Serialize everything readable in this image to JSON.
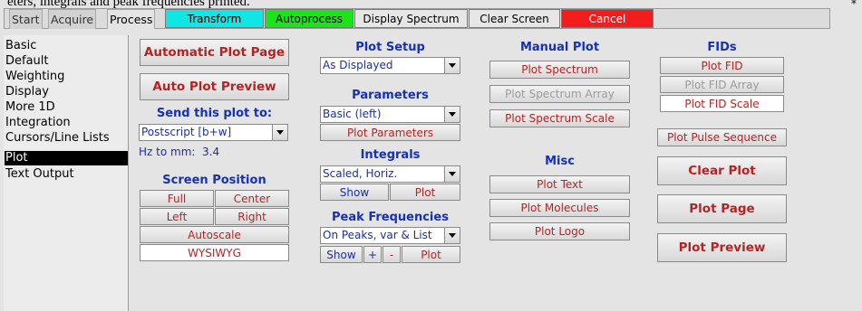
{
  "header_cut_text": "eters, integrals and peak frequencies printed.",
  "corner_mark": "*",
  "tabs": [
    "Start",
    "Acquire",
    "Process"
  ],
  "toolbar": {
    "transform": "Transform",
    "autoprocess": "Autoprocess",
    "display_spectrum": "Display Spectrum",
    "clear_screen": "Clear Screen",
    "cancel": "Cancel"
  },
  "sidebar": {
    "items": [
      "Basic",
      "Default",
      "Weighting",
      "Display",
      "More 1D",
      "Integration",
      "Cursors/Line Lists",
      "Plot",
      "Text Output"
    ],
    "selected": "Plot"
  },
  "col1": {
    "automatic_plot_page": "Automatic Plot Page",
    "auto_plot_preview": "Auto Plot Preview",
    "send_to_label": "Send this plot to:",
    "send_to_value": "Postscript [b+w]",
    "hz_to_mm_label": "Hz to mm:",
    "hz_to_mm_value": "3.4",
    "screen_position_title": "Screen Position",
    "full": "Full",
    "center": "Center",
    "left": "Left",
    "right": "Right",
    "autoscale": "Autoscale",
    "wysiwyg": "WYSIWYG"
  },
  "col2": {
    "plot_setup_title": "Plot Setup",
    "plot_setup_value": "As Displayed",
    "parameters_title": "Parameters",
    "parameters_value": "Basic (left)",
    "plot_parameters": "Plot Parameters",
    "integrals_title": "Integrals",
    "integrals_value": "Scaled, Horiz.",
    "show": "Show",
    "plot": "Plot",
    "peak_freq_title": "Peak Frequencies",
    "peak_freq_value": "On Peaks, var & List",
    "plus": "+",
    "minus": "-"
  },
  "col3": {
    "manual_plot_title": "Manual Plot",
    "plot_spectrum": "Plot Spectrum",
    "plot_spectrum_array": "Plot Spectrum Array",
    "plot_spectrum_scale": "Plot Spectrum Scale",
    "misc_title": "Misc",
    "plot_text": "Plot Text",
    "plot_molecules": "Plot Molecules",
    "plot_logo": "Plot Logo"
  },
  "col4": {
    "fids_title": "FIDs",
    "plot_fid": "Plot FID",
    "plot_fid_array": "Plot FID Array",
    "plot_fid_scale": "Plot FID Scale",
    "plot_pulse_sequence": "Plot Pulse Sequence",
    "clear_plot": "Clear Plot",
    "plot_page": "Plot Page",
    "plot_preview": "Plot Preview"
  },
  "colors": {
    "transform": "#11e6e6",
    "autoprocess": "#1be41b",
    "cancel": "#f41c1c",
    "header_blue": "#1730b8",
    "button_red": "#b52424"
  }
}
